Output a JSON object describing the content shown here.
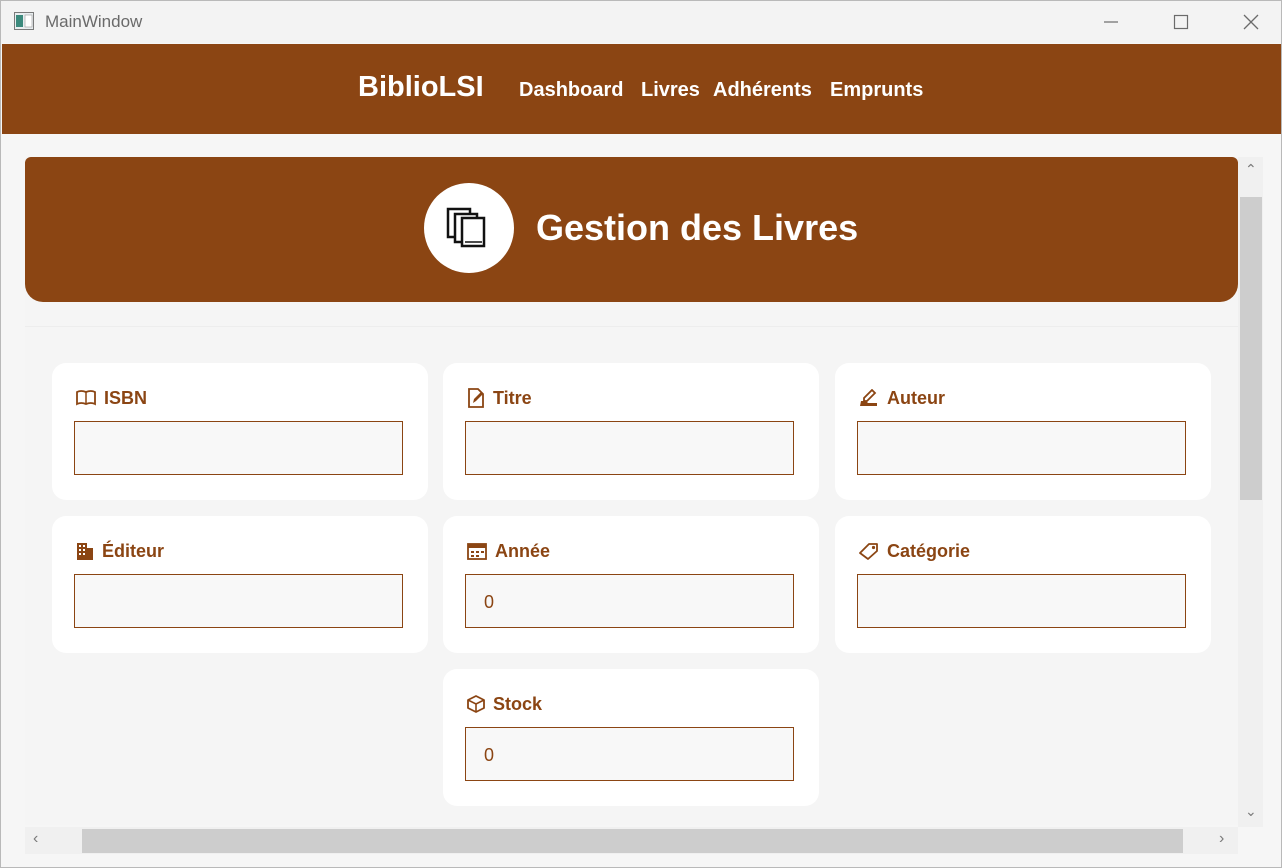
{
  "window": {
    "title": "MainWindow",
    "icons": {
      "app": "app-window-icon",
      "minimize": "minimize-icon",
      "maximize": "maximize-icon",
      "close": "close-icon"
    }
  },
  "nav": {
    "brand": "BiblioLSI",
    "links": [
      "Dashboard",
      "Livres",
      "Adhérents",
      "Emprunts"
    ]
  },
  "header": {
    "title": "Gestion des Livres",
    "icon": "books-icon"
  },
  "form": {
    "fields": [
      {
        "label": "ISBN",
        "value": "",
        "icon": "open-book-icon"
      },
      {
        "label": "Titre",
        "value": "",
        "icon": "edit-document-icon"
      },
      {
        "label": "Auteur",
        "value": "",
        "icon": "writing-hand-icon"
      },
      {
        "label": "Éditeur",
        "value": "",
        "icon": "building-icon"
      },
      {
        "label": "Année",
        "value": "0",
        "icon": "calendar-icon"
      },
      {
        "label": "Catégorie",
        "value": "",
        "icon": "tag-icon"
      },
      {
        "label": "Stock",
        "value": "0",
        "icon": "box-icon"
      }
    ]
  },
  "colors": {
    "brand": "#8b4513",
    "panel": "#f5f5f5",
    "card": "#ffffff"
  }
}
